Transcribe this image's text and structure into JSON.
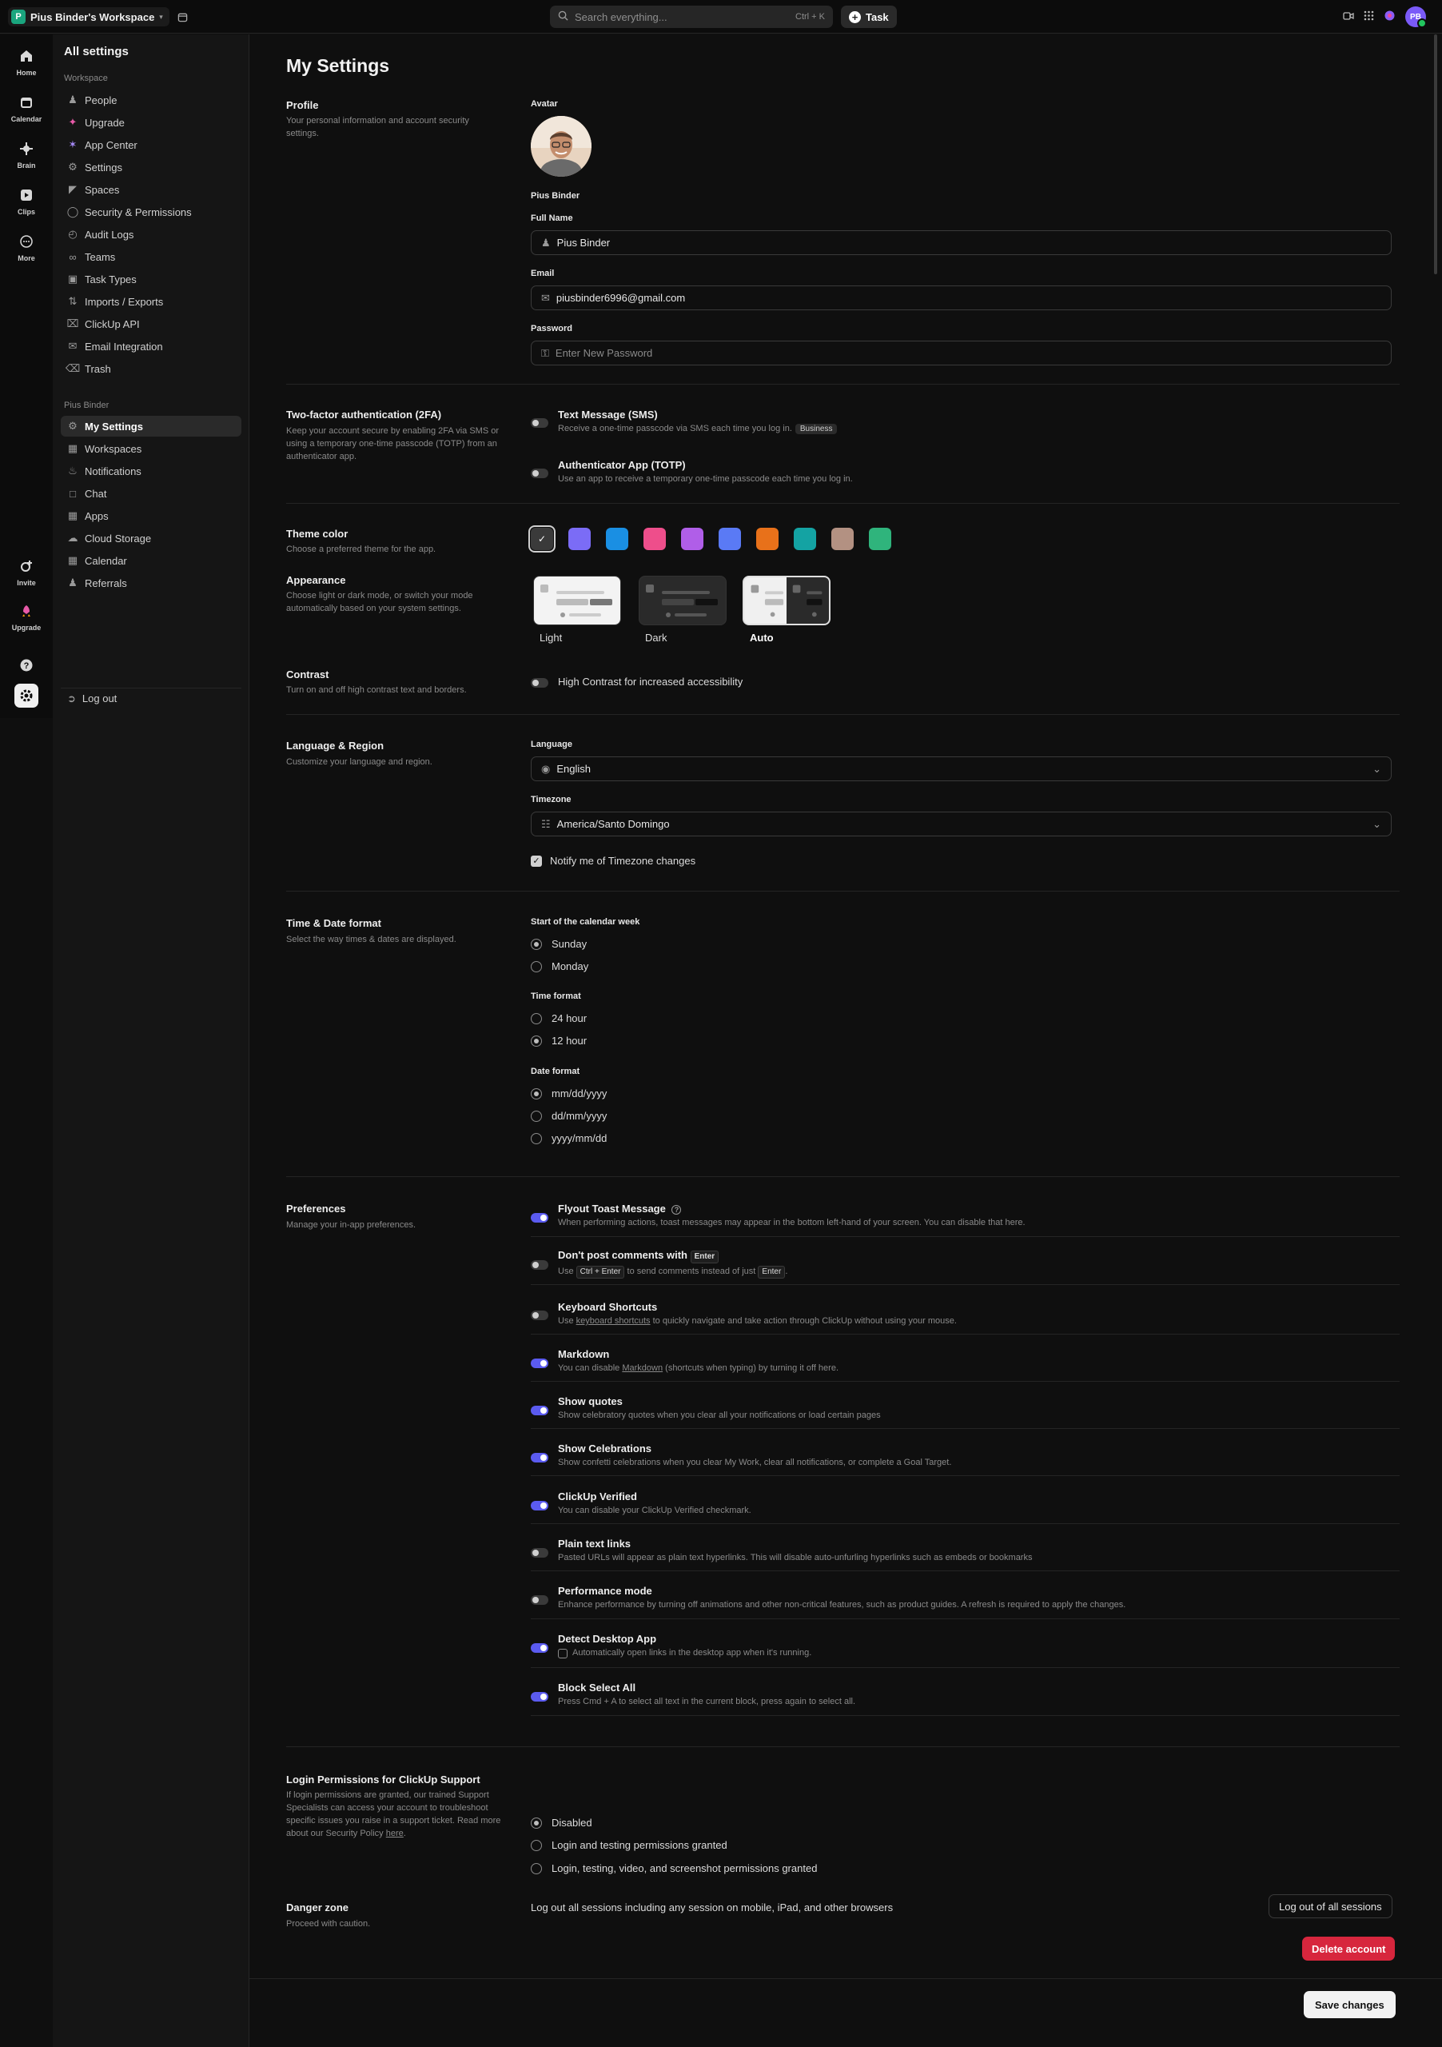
{
  "topbar": {
    "workspace_initial": "P",
    "workspace_name": "Pius Binder's Workspace",
    "search_placeholder": "Search everything...",
    "search_shortcut": "Ctrl + K",
    "task_label": "Task",
    "user_initials": "PB"
  },
  "rail": {
    "home": "Home",
    "calendar": "Calendar",
    "brain": "Brain",
    "clips": "Clips",
    "more": "More",
    "invite": "Invite",
    "upgrade": "Upgrade"
  },
  "sidebar": {
    "title": "All settings",
    "workspace_section": "Workspace",
    "workspace_items": [
      "People",
      "Upgrade",
      "App Center",
      "Settings",
      "Spaces",
      "Security & Permissions",
      "Audit Logs",
      "Teams",
      "Task Types",
      "Imports / Exports",
      "ClickUp API",
      "Email Integration",
      "Trash"
    ],
    "user_section": "Pius Binder",
    "user_items": [
      "My Settings",
      "Workspaces",
      "Notifications",
      "Chat",
      "Apps",
      "Cloud Storage",
      "Calendar",
      "Referrals"
    ],
    "logout": "Log out"
  },
  "page": {
    "title": "My Settings",
    "profile": {
      "label": "Profile",
      "desc": "Your personal information and account security settings.",
      "avatar_label": "Avatar",
      "avatar_name": "Pius Binder",
      "fullname_label": "Full Name",
      "fullname_value": "Pius Binder",
      "email_label": "Email",
      "email_value": "piusbinder6996@gmail.com",
      "password_label": "Password",
      "password_placeholder": "Enter New Password"
    },
    "twofa": {
      "label": "Two-factor authentication (2FA)",
      "desc": "Keep your account secure by enabling 2FA via SMS or using a temporary one-time passcode (TOTP) from an authenticator app.",
      "sms_title": "Text Message (SMS)",
      "sms_desc": "Receive a one-time passcode via SMS each time you log in.",
      "sms_chip": "Business",
      "totp_title": "Authenticator App (TOTP)",
      "totp_desc": "Use an app to receive a temporary one-time passcode each time you log in."
    },
    "theme": {
      "label": "Theme color",
      "desc": "Choose a preferred theme for the app.",
      "colors": [
        "#3a3a3a",
        "#7b6cf6",
        "#1a8fe3",
        "#ee4e8b",
        "#b05ee8",
        "#5a7af5",
        "#e8711a",
        "#14a3a3",
        "#b39182",
        "#2fb47c"
      ]
    },
    "appearance": {
      "label": "Appearance",
      "desc": "Choose light or dark mode, or switch your mode automatically based on your system settings.",
      "options": [
        "Light",
        "Dark",
        "Auto"
      ],
      "selected": "Auto"
    },
    "contrast": {
      "label": "Contrast",
      "desc": "Turn on and off high contrast text and borders.",
      "option": "High Contrast for increased accessibility"
    },
    "language": {
      "label": "Language & Region",
      "desc": "Customize your language and region.",
      "language_label": "Language",
      "language_value": "English",
      "timezone_label": "Timezone",
      "timezone_value": "America/Santo Domingo",
      "notify_tz": "Notify me of Timezone changes"
    },
    "datetime": {
      "label": "Time & Date format",
      "desc": "Select the way times & dates are displayed.",
      "week_label": "Start of the calendar week",
      "week_options": [
        "Sunday",
        "Monday"
      ],
      "time_label": "Time format",
      "time_options": [
        "24 hour",
        "12 hour"
      ],
      "date_label": "Date format",
      "date_options": [
        "mm/dd/yyyy",
        "dd/mm/yyyy",
        "yyyy/mm/dd"
      ]
    },
    "preferences": {
      "label": "Preferences",
      "desc": "Manage your in-app preferences.",
      "flyout_title": "Flyout Toast Message",
      "flyout_desc": "When performing actions, toast messages may appear in the bottom left-hand of your screen. You can disable that here.",
      "dontpost_title": "Don't post comments with",
      "dontpost_key": "Enter",
      "dontpost_use": "Use",
      "dontpost_key2": "Ctrl + Enter",
      "dontpost_mid": "to send comments instead of just",
      "dontpost_key3": "Enter",
      "keyboard_title": "Keyboard Shortcuts",
      "keyboard_use": "Use",
      "keyboard_link": "keyboard shortcuts",
      "keyboard_rest": "to quickly navigate and take action through ClickUp without using your mouse.",
      "markdown_title": "Markdown",
      "markdown_pre": "You can disable",
      "markdown_link": "Markdown",
      "markdown_rest": "(shortcuts when typing) by turning it off here.",
      "quotes_title": "Show quotes",
      "quotes_desc": "Show celebratory quotes when you clear all your notifications or load certain pages",
      "celebrations_title": "Show Celebrations",
      "celebrations_desc": "Show confetti celebrations when you clear My Work, clear all notifications, or complete a Goal Target.",
      "verified_title": "ClickUp Verified",
      "verified_desc": "You can disable your ClickUp Verified checkmark.",
      "plaintext_title": "Plain text links",
      "plaintext_desc": "Pasted URLs will appear as plain text hyperlinks. This will disable auto-unfurling hyperlinks such as embeds or bookmarks",
      "performance_title": "Performance mode",
      "performance_desc": "Enhance performance by turning off animations and other non-critical features, such as product guides. A refresh is required to apply the changes.",
      "desktop_title": "Detect Desktop App",
      "desktop_desc": "Automatically open links in the desktop app when it's running.",
      "blockselect_title": "Block Select All",
      "blockselect_desc": "Press Cmd + A to select all text in the current block, press again to select all."
    },
    "login_perm": {
      "label": "Login Permissions for ClickUp Support",
      "desc_pre": "If login permissions are granted, our trained Support Specialists can access your account to troubleshoot specific issues you raise in a support ticket. Read more about our Security Policy",
      "desc_link": "here",
      "options": [
        "Disabled",
        "Login and testing permissions granted",
        "Login, testing, video, and screenshot permissions granted"
      ]
    },
    "danger": {
      "label": "Danger zone",
      "desc": "Proceed with caution.",
      "sessions_text": "Log out all sessions including any session on mobile, iPad, and other browsers",
      "sessions_btn": "Log out of all sessions",
      "delete_btn": "Delete account"
    },
    "save": "Save changes"
  }
}
